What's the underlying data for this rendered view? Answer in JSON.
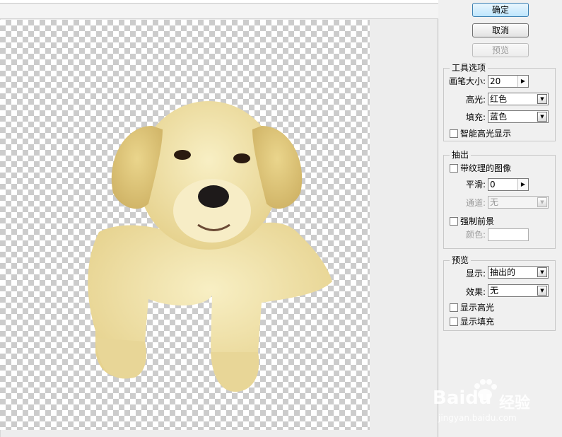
{
  "buttons": {
    "ok": "确定",
    "cancel": "取消",
    "preview": "预览"
  },
  "tool_options": {
    "title": "工具选项",
    "brush_size_label": "画笔大小:",
    "brush_size_value": "20",
    "highlight_label": "高光:",
    "highlight_value": "红色",
    "fill_label": "填充:",
    "fill_value": "蓝色",
    "smart_highlight_label": "智能高光显示",
    "smart_highlight_checked": false
  },
  "extract": {
    "title": "抽出",
    "textured_image_label": "带纹理的图像",
    "textured_image_checked": false,
    "smooth_label": "平滑:",
    "smooth_value": "0",
    "channel_label": "通道:",
    "channel_value": "无",
    "force_foreground_label": "强制前景",
    "force_foreground_checked": false,
    "color_label": "颜色:",
    "color_value": ""
  },
  "preview_group": {
    "title": "预览",
    "show_label": "显示:",
    "show_value": "抽出的",
    "effect_label": "效果:",
    "effect_value": "无",
    "show_highlight_label": "显示高光",
    "show_highlight_checked": false,
    "show_fill_label": "显示填充",
    "show_fill_checked": false
  },
  "watermark": {
    "brand": "Baidu",
    "brand_cn": "经验",
    "url": "jingyan.baidu.com"
  },
  "colors": {
    "dog_fur": "#efe2a8",
    "dog_shadow": "#d8c47c",
    "panel_bg": "#f0f0f0"
  }
}
